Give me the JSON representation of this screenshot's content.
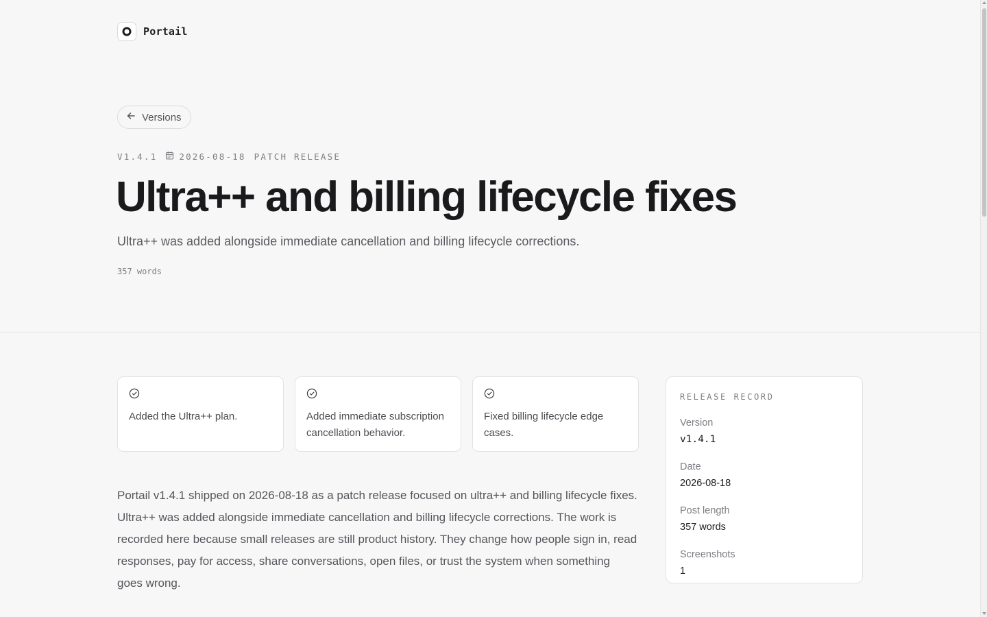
{
  "brand": {
    "name": "Portail",
    "icon": "ring-logo-icon"
  },
  "nav": {
    "back_label": "Versions",
    "back_icon": "arrow-left-icon"
  },
  "meta": {
    "version": "V1.4.1",
    "date": "2026-08-18",
    "date_icon": "calendar-icon",
    "release_type": "PATCH RELEASE"
  },
  "title": "Ultra++ and billing lifecycle fixes",
  "subtitle": "Ultra++ was added alongside immediate cancellation and billing lifecycle corrections.",
  "word_count": "357 words",
  "highlights": [
    {
      "icon": "check-circle-icon",
      "text": "Added the Ultra++ plan."
    },
    {
      "icon": "check-circle-icon",
      "text": "Added immediate subscription cancellation behavior."
    },
    {
      "icon": "check-circle-icon",
      "text": "Fixed billing lifecycle edge cases."
    }
  ],
  "body": "Portail v1.4.1 shipped on 2026-08-18 as a patch release focused on ultra++ and billing lifecycle fixes. Ultra++ was added alongside immediate cancellation and billing lifecycle corrections. The work is recorded here because small releases are still product history. They change how people sign in, read responses, pay for access, share conversations, open files, or trust the system when something goes wrong.",
  "record": {
    "title": "RELEASE RECORD",
    "items": [
      {
        "label": "Version",
        "value": "v1.4.1"
      },
      {
        "label": "Date",
        "value": "2026-08-18"
      },
      {
        "label": "Post length",
        "value": "357 words"
      },
      {
        "label": "Screenshots",
        "value": "1"
      }
    ]
  },
  "colors": {
    "background": "#f7f7f7",
    "text": "#1a1a1c",
    "muted": "#7d7d83",
    "border": "#e2e2e5"
  }
}
